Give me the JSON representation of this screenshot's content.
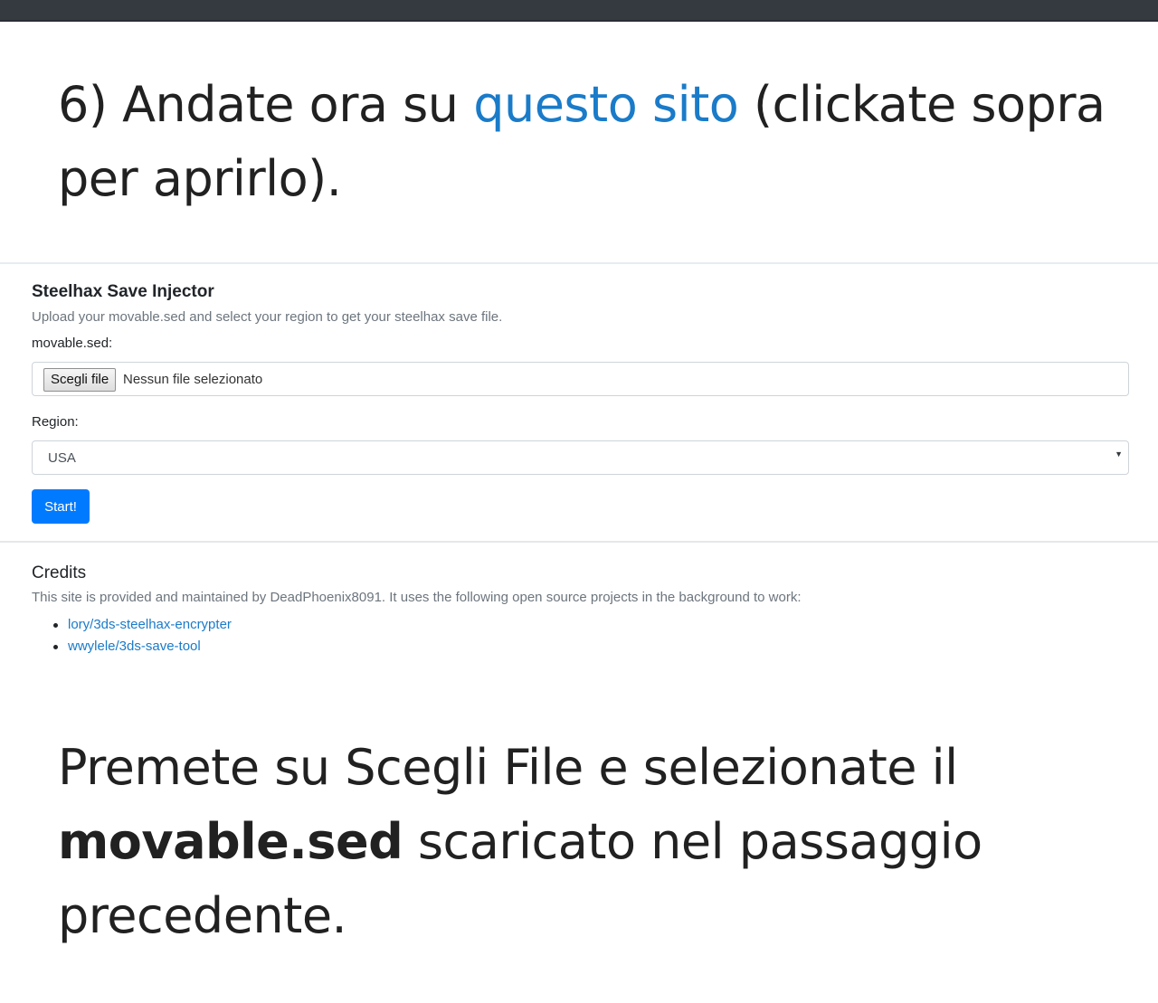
{
  "step": {
    "prefix": "6) Andate ora su ",
    "link_text": "questo sito",
    "suffix": " (clickate sopra per aprirlo)."
  },
  "injector": {
    "title": "Steelhax Save Injector",
    "description": "Upload your movable.sed and select your region to get your steelhax save file.",
    "file_label": "movable.sed:",
    "file_button": "Scegli file",
    "file_status": "Nessun file selezionato",
    "region_label": "Region:",
    "region_value": "USA",
    "start_button": "Start!"
  },
  "credits": {
    "title": "Credits",
    "description": "This site is provided and maintained by DeadPhoenix8091. It uses the following open source projects in the background to work:",
    "links": [
      "lory/3ds-steelhax-encrypter",
      "wwylele/3ds-save-tool"
    ]
  },
  "instruction": {
    "part1": "Premete su Scegli File e selezionate il ",
    "bold": "movable.sed",
    "part2": " scaricato nel passaggio precedente."
  },
  "colors": {
    "link": "#1a7bc9",
    "primary_button": "#007bff",
    "top_bar": "#343a40"
  }
}
